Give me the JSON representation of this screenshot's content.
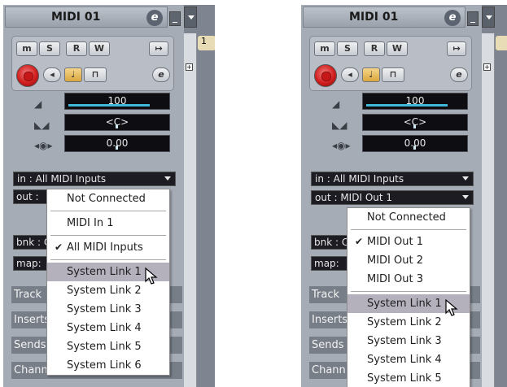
{
  "left": {
    "title": "MIDI 01",
    "e_label": "e",
    "buttons": {
      "m": "m",
      "s": "S",
      "r": "R",
      "w": "W",
      "e_small": "e"
    },
    "volume": "100",
    "pan": "<C>",
    "delay": "0.00",
    "in_label": "in : ",
    "in_value": "All MIDI Inputs",
    "out_label": "out : ",
    "bnk_label": "bnk : C",
    "map_label": "map:",
    "sections": [
      "Track",
      "Inserts",
      "Sends",
      "Chann"
    ],
    "menu": [
      {
        "label": "Not Connected",
        "type": "item"
      },
      {
        "type": "sep"
      },
      {
        "label": "MIDI In 1",
        "type": "item"
      },
      {
        "type": "sep"
      },
      {
        "label": "All MIDI Inputs",
        "type": "item",
        "checked": true
      },
      {
        "type": "sep"
      },
      {
        "label": "System Link 1",
        "type": "item",
        "highlighted": true
      },
      {
        "label": "System Link 2",
        "type": "item"
      },
      {
        "label": "System Link 3",
        "type": "item"
      },
      {
        "label": "System Link 4",
        "type": "item"
      },
      {
        "label": "System Link 5",
        "type": "item"
      },
      {
        "label": "System Link 6",
        "type": "item"
      }
    ],
    "side_item": "1"
  },
  "right": {
    "title": "MIDI 01",
    "e_label": "e",
    "volume": "100",
    "pan": "<C>",
    "delay": "0.00",
    "in_label": "in : ",
    "in_value": "All MIDI Inputs",
    "out_label": "out : ",
    "out_value": "MIDI Out 1",
    "bnk_label": "bnk : C",
    "map_label": "map:",
    "sections": [
      "Track",
      "Inserts",
      "Sends",
      "Chann"
    ],
    "menu": [
      {
        "label": "Not Connected",
        "type": "item"
      },
      {
        "type": "sep"
      },
      {
        "label": "MIDI Out 1",
        "type": "item",
        "checked": true
      },
      {
        "label": "MIDI Out 2",
        "type": "item"
      },
      {
        "label": "MIDI Out 3",
        "type": "item"
      },
      {
        "type": "sep"
      },
      {
        "label": "System Link 1",
        "type": "item",
        "highlighted": true
      },
      {
        "label": "System Link 2",
        "type": "item"
      },
      {
        "label": "System Link 3",
        "type": "item"
      },
      {
        "label": "System Link 4",
        "type": "item"
      },
      {
        "label": "System Link 5",
        "type": "item"
      }
    ]
  },
  "colors": {
    "accent": "#3fb8d8",
    "highlight": "#b4b1bd",
    "record": "#d21e1e"
  },
  "icons": [
    "volume-icon",
    "pan-icon",
    "delay-icon",
    "record-icon",
    "monitor-icon",
    "lock-icon",
    "arrow-cursor-icon"
  ]
}
